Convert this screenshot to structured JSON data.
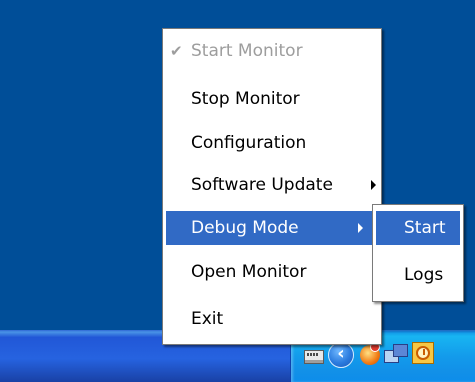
{
  "menu": {
    "items": [
      {
        "label": "Start Monitor",
        "state": "disabled",
        "checked": true
      },
      {
        "label": "Stop Monitor"
      },
      {
        "label": "Configuration"
      },
      {
        "label": "Software Update",
        "has_submenu": true
      },
      {
        "label": "Debug Mode",
        "has_submenu": true,
        "state": "highlighted"
      },
      {
        "label": "Open Monitor"
      },
      {
        "label": "Exit"
      }
    ],
    "check_mark": "✔"
  },
  "submenu": {
    "items": [
      {
        "label": "Start",
        "state": "highlighted"
      },
      {
        "label": "Logs"
      }
    ]
  },
  "tray": {
    "icons": [
      "keyboard-icon",
      "show-hidden-icons-icon",
      "security-alert-icon",
      "network-icon",
      "clock-icon"
    ],
    "chevron_glyph": "‹"
  },
  "colors": {
    "desktop": "#004e98",
    "highlight": "#316ac5",
    "disabled_text": "#9d9d9d",
    "taskbar": "#2663e0",
    "tray": "#139beb"
  }
}
